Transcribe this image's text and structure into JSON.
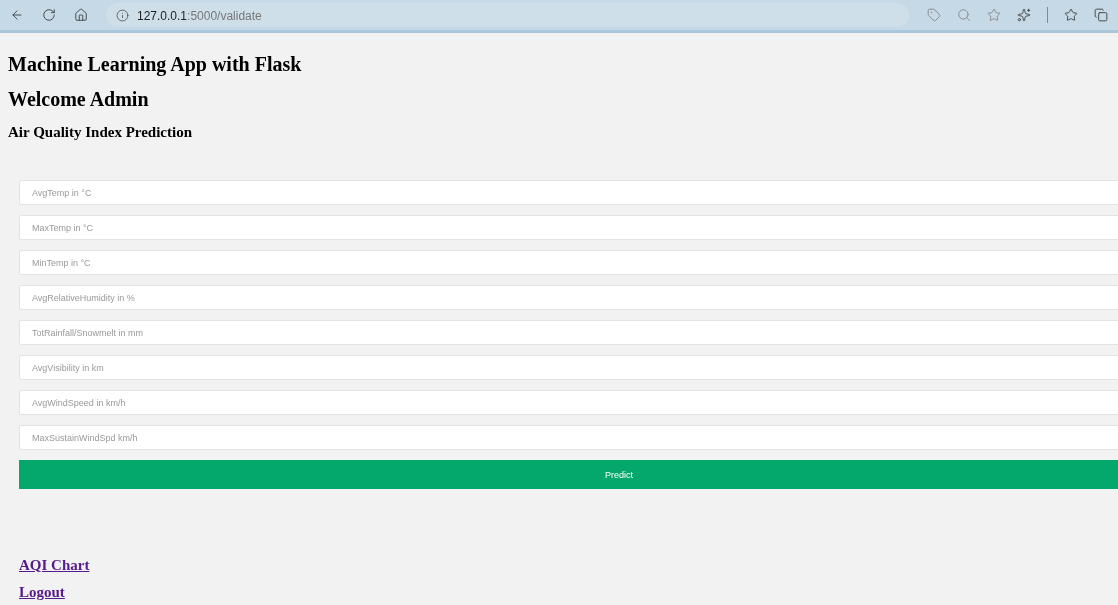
{
  "browser": {
    "url_host": "127.0.0.1",
    "url_path": ":5000/validate"
  },
  "headings": [
    "Machine Learning App with Flask",
    "Welcome Admin",
    "Air Quality Index Prediction"
  ],
  "fields": [
    {
      "placeholder": "AvgTemp in °C"
    },
    {
      "placeholder": "MaxTemp in °C"
    },
    {
      "placeholder": "MinTemp in °C"
    },
    {
      "placeholder": "AvgRelativeHumidity in %"
    },
    {
      "placeholder": "TotRainfall/Snowmelt in mm"
    },
    {
      "placeholder": "AvgVisibility in km"
    },
    {
      "placeholder": "AvgWindSpeed in km/h"
    },
    {
      "placeholder": "MaxSustainWindSpd km/h"
    }
  ],
  "submit": "Predict",
  "links": [
    "AQI Chart",
    "Logout"
  ]
}
